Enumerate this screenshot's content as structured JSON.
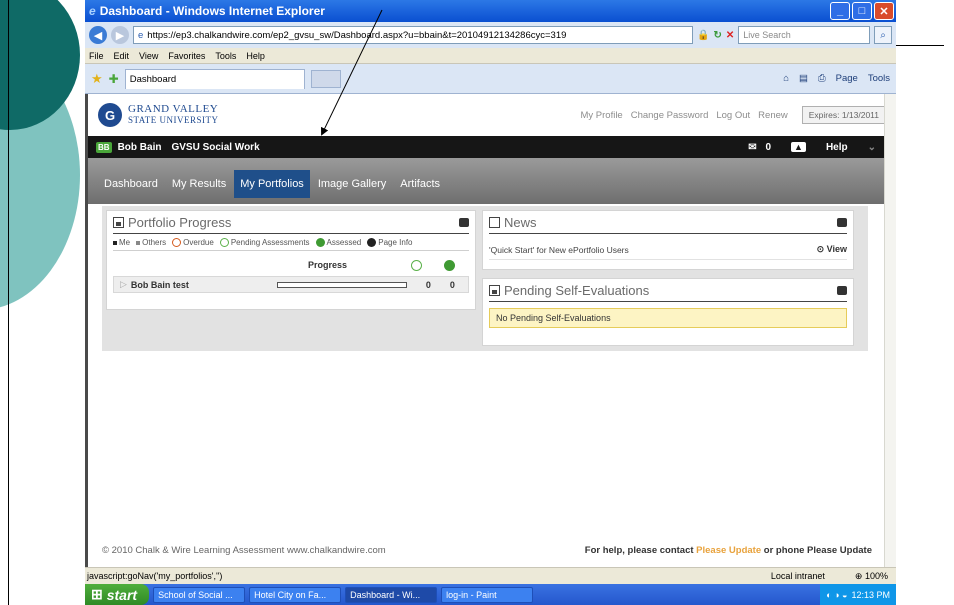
{
  "window": {
    "title": "Dashboard - Windows Internet Explorer"
  },
  "browser": {
    "url": "https://ep3.chalkandwire.com/ep2_gvsu_sw/Dashboard.aspx?u=bbain&t=20104912134286cyc=319",
    "search_placeholder": "Live Search",
    "menu": [
      "File",
      "Edit",
      "View",
      "Favorites",
      "Tools",
      "Help"
    ],
    "tab_label": "Dashboard",
    "toolbar": {
      "page": "Page",
      "tools": "Tools"
    }
  },
  "site": {
    "logo_line1": "GRAND VALLEY",
    "logo_line2": "STATE UNIVERSITY",
    "topnav": [
      "My Profile",
      "Change Password",
      "Log Out",
      "Renew"
    ],
    "expires": "Expires: 1/13/2011",
    "user_chip": "BB",
    "user": "Bob Bain",
    "program": "GVSU Social Work",
    "msg_count": "0",
    "help": "Help",
    "tabs": [
      "Dashboard",
      "My Results",
      "My Portfolios",
      "Image Gallery",
      "Artifacts"
    ],
    "active_tab": "My Portfolios"
  },
  "portfolio_panel": {
    "title": "Portfolio Progress",
    "legend": [
      "Me",
      "Others",
      "Overdue",
      "Pending Assessments",
      "Assessed",
      "Page Info"
    ],
    "progress_header": "Progress",
    "row": {
      "name": "Bob Bain test",
      "progress": 0,
      "pending": "0",
      "assessed": "0"
    }
  },
  "news_panel": {
    "title": "News",
    "item": "'Quick Start' for New ePortfolio Users",
    "view": "View"
  },
  "pending_panel": {
    "title": "Pending Self-Evaluations",
    "message": "No Pending Self-Evaluations"
  },
  "footer": {
    "copyright": "© 2010 Chalk & Wire Learning Assessment   www.chalkandwire.com",
    "help_prefix": "For help, please contact",
    "help_link": "Please Update",
    "help_suffix": "or phone Please Update"
  },
  "status": {
    "text": "javascript:goNav('my_portfolios','')",
    "zone": "Local intranet",
    "zoom": "100%"
  },
  "taskbar": {
    "start": "start",
    "buttons": [
      "School of Social ...",
      "Hotel City on Fa...",
      "Dashboard - Wi...",
      "log-in - Paint"
    ],
    "clock": "12:13 PM"
  },
  "colors": {
    "teal_dark": "#0f6a66",
    "teal_light": "#7fc3bf",
    "gvsu_blue": "#1f4a90",
    "active_tab": "#1f4f8a"
  }
}
